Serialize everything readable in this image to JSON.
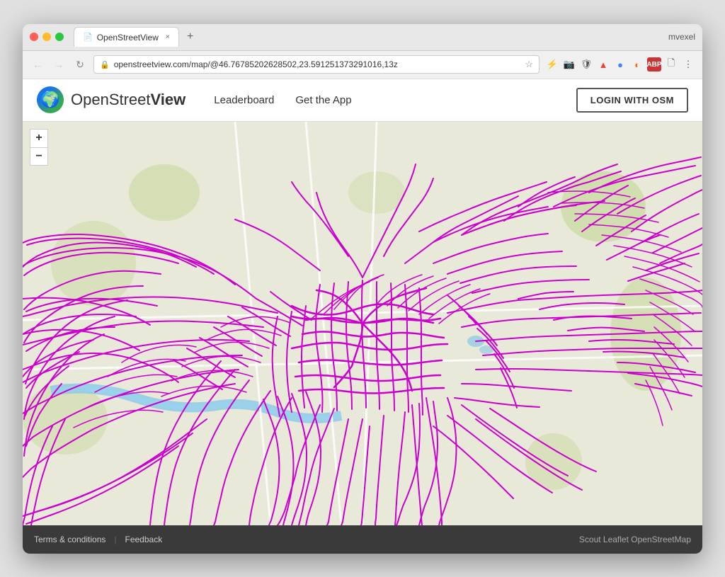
{
  "browser": {
    "tab_favicon": "📄",
    "tab_title": "OpenStreetView",
    "tab_close": "×",
    "new_tab": "+",
    "window_user": "mvexel",
    "nav_back": "←",
    "nav_forward": "→",
    "nav_refresh": "↻",
    "address_url": "openstreetview.com/map/@46.76785202628502,23.591251373291016,13z",
    "address_lock": "🔒",
    "address_star": "☆"
  },
  "header": {
    "logo_emoji": "🌍",
    "logo_title_prefix": "OpenStreet",
    "logo_title_suffix": "View",
    "nav_items": [
      "Leaderboard",
      "Get the App"
    ],
    "login_button": "LOGIN WITH OSM"
  },
  "map": {
    "zoom_in": "+",
    "zoom_out": "−",
    "accent_color": "#cc00cc"
  },
  "footer": {
    "terms": "Terms & conditions",
    "separator": "|",
    "feedback": "Feedback",
    "right_credits": "Scout   Leaflet   OpenStreetMap"
  }
}
